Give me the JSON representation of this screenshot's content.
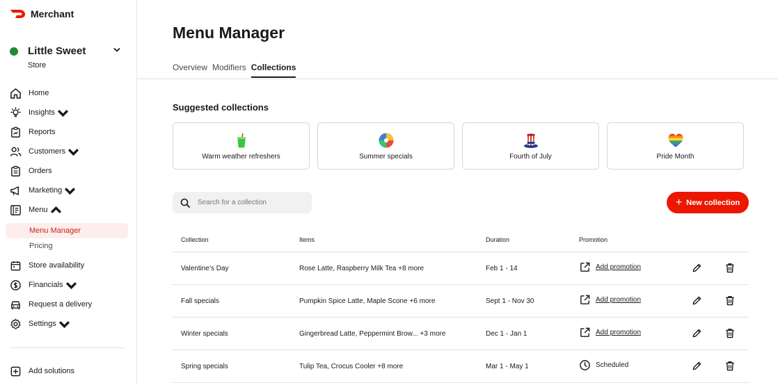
{
  "brand": {
    "name": "Merchant",
    "color": "#eb1700"
  },
  "store": {
    "name": "Little Sweet",
    "subtitle": "Store",
    "status_color": "#1f8a36"
  },
  "nav": {
    "home": "Home",
    "insights": "Insights",
    "reports": "Reports",
    "customers": "Customers",
    "orders": "Orders",
    "marketing": "Marketing",
    "menu": "Menu",
    "menu_manager": "Menu Manager",
    "pricing": "Pricing",
    "store_availability": "Store availability",
    "financials": "Financials",
    "request_delivery": "Request a delivery",
    "settings": "Settings",
    "add_solutions": "Add solutions"
  },
  "page": {
    "title": "Menu Manager",
    "tabs": [
      "Overview",
      "Modifiers",
      "Collections"
    ],
    "active_tab": "Collections"
  },
  "suggested": {
    "title": "Suggested collections",
    "cards": [
      {
        "label": "Warm weather refreshers",
        "icon": "drink-icon"
      },
      {
        "label": "Summer specials",
        "icon": "beach-ball-icon"
      },
      {
        "label": "Fourth of July",
        "icon": "uncle-sam-hat-icon"
      },
      {
        "label": "Pride Month",
        "icon": "rainbow-heart-icon"
      }
    ]
  },
  "search": {
    "placeholder": "Search for a collection",
    "value": ""
  },
  "new_button": "New collection",
  "table": {
    "headers": [
      "Collection",
      "Items",
      "Duration",
      "Promotion"
    ],
    "rows": [
      {
        "collection": "Valentine’s Day",
        "items": "Rose Latte, Raspberry Milk Tea +8 more",
        "duration": "Feb 1 - 14",
        "promotion": "Add promotion",
        "promo_icon": "external-link-icon"
      },
      {
        "collection": "Fall specials",
        "items": "Pumpkin Spice Latte, Maple Scone +6 more",
        "duration": "Sept 1 - Nov 30",
        "promotion": "Add promotion",
        "promo_icon": "external-link-icon"
      },
      {
        "collection": "Winter specials",
        "items": "Gingerbread Latte, Peppermint Brow... +3 more",
        "duration": "Dec 1 - Jan 1",
        "promotion": "Add promotion",
        "promo_icon": "external-link-icon"
      },
      {
        "collection": "Spring specials",
        "items": "Tulip Tea, Crocus Cooler +8 more",
        "duration": "Mar 1 - May 1",
        "promotion": "Scheduled",
        "promo_icon": "clock-icon"
      }
    ]
  }
}
